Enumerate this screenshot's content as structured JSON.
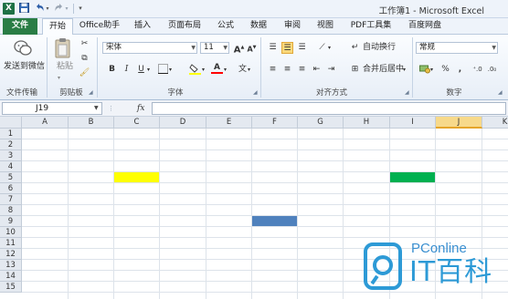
{
  "app": {
    "window_title": "工作簿1 - Microsoft Excel",
    "logo_letter": "X"
  },
  "quick_access": {
    "undo_icon": "undo-icon",
    "redo_icon": "redo-icon"
  },
  "tabs": [
    {
      "label": "文件",
      "active": false
    },
    {
      "label": "开始",
      "active": true
    },
    {
      "label": "Office助手",
      "active": false
    },
    {
      "label": "插入",
      "active": false
    },
    {
      "label": "页面布局",
      "active": false
    },
    {
      "label": "公式",
      "active": false
    },
    {
      "label": "数据",
      "active": false
    },
    {
      "label": "审阅",
      "active": false
    },
    {
      "label": "视图",
      "active": false
    },
    {
      "label": "PDF工具集",
      "active": false
    },
    {
      "label": "百度网盘",
      "active": false
    }
  ],
  "ribbon": {
    "file_transfer": {
      "send_label": "发送到微信",
      "group_label": "文件传输"
    },
    "clipboard": {
      "paste_label": "粘贴",
      "group_label": "剪贴板"
    },
    "font": {
      "font_name": "宋体",
      "font_size": "11",
      "grow_label": "A",
      "shrink_label": "A",
      "bold_label": "B",
      "italic_label": "I",
      "underline_label": "U",
      "wen_label": "文",
      "group_label": "字体"
    },
    "alignment": {
      "wrap_label": "自动换行",
      "merge_label": "合并后居中",
      "group_label": "对齐方式"
    },
    "number": {
      "format": "常规",
      "percent_label": "%",
      "comma_label": ",",
      "group_label": "数字"
    }
  },
  "formula_bar": {
    "name_box": "J19",
    "fx_label": "fx",
    "formula": ""
  },
  "sheet": {
    "columns": [
      "A",
      "B",
      "C",
      "D",
      "E",
      "F",
      "G",
      "H",
      "I",
      "J",
      "K"
    ],
    "active_column": "J",
    "rows": [
      "1",
      "2",
      "3",
      "4",
      "5",
      "6",
      "7",
      "8",
      "9",
      "10",
      "11",
      "12",
      "13",
      "14",
      "15"
    ],
    "filled_cells": [
      {
        "col": "C",
        "row": "5",
        "color": "#ffff00"
      },
      {
        "col": "I",
        "row": "5",
        "color": "#00b050"
      },
      {
        "col": "F",
        "row": "9",
        "color": "#4f81bd"
      }
    ]
  },
  "watermark": {
    "brand": "PConline",
    "name": "IT百科"
  }
}
